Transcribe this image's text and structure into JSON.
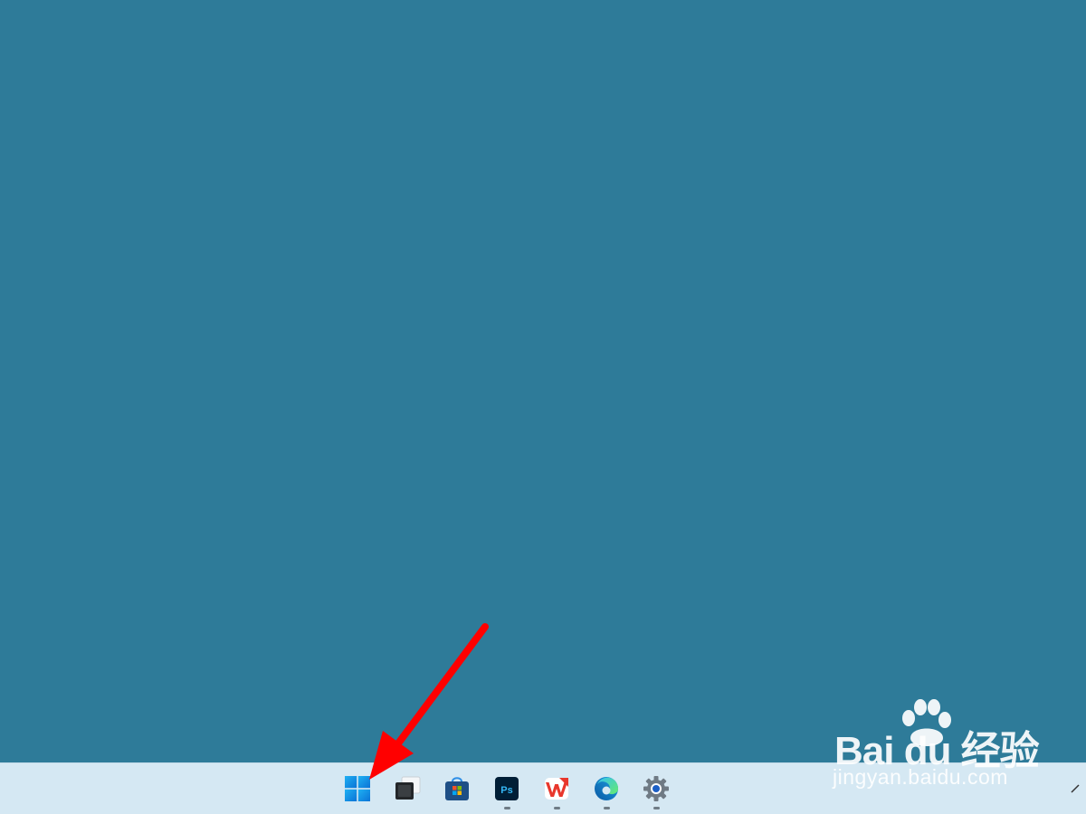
{
  "desktop": {
    "background_color": "#2e7b99"
  },
  "taskbar": {
    "background_color": "#d5e8f3",
    "items": [
      {
        "id": "start",
        "icon": "windows-start-icon",
        "running": false
      },
      {
        "id": "task-view",
        "icon": "task-view-icon",
        "running": false
      },
      {
        "id": "store",
        "icon": "microsoft-store-icon",
        "running": false
      },
      {
        "id": "photoshop",
        "icon": "photoshop-icon",
        "label": "Ps",
        "running": true
      },
      {
        "id": "wps",
        "icon": "wps-office-icon",
        "label": "W",
        "running": true
      },
      {
        "id": "edge",
        "icon": "edge-browser-icon",
        "running": true
      },
      {
        "id": "settings",
        "icon": "settings-gear-icon",
        "running": true
      }
    ],
    "tray": {
      "icon": "show-hidden-icons-chevron"
    }
  },
  "annotation": {
    "type": "arrow",
    "color": "#ff0000",
    "points_to": "start"
  },
  "watermark": {
    "logo_text": "Bai du 经验",
    "url": "jingyan.baidu.com"
  }
}
